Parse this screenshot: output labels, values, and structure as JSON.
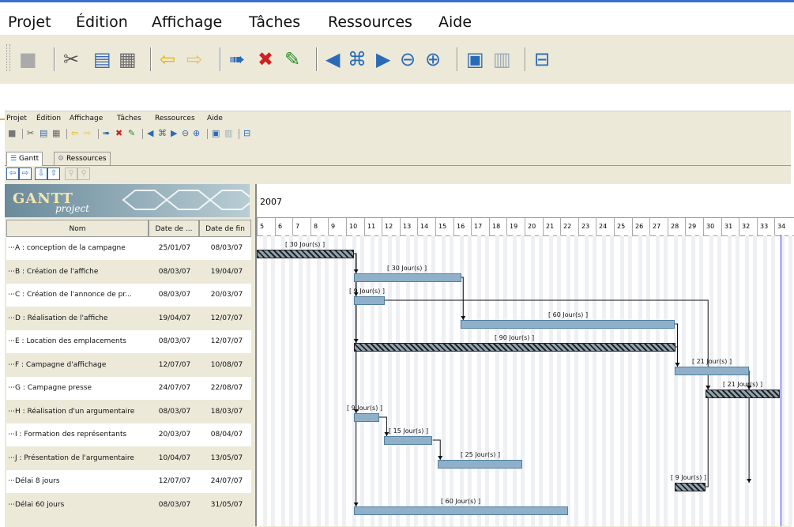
{
  "menu": [
    "Projet",
    "Édition",
    "Affichage",
    "Tâches",
    "Ressources",
    "Aide"
  ],
  "toolbar_icons": [
    "save-icon",
    "cut-icon",
    "copy-icon",
    "paste-icon",
    "undo-icon",
    "redo-icon",
    "new-task-icon",
    "delete-task-icon",
    "properties-icon",
    "unindent-icon",
    "link-icon",
    "indent-icon",
    "zoom-out-icon",
    "zoom-in-icon",
    "print-preview-icon",
    "resource-icon",
    "export-icon"
  ],
  "tabs": {
    "gantt": "Gantt",
    "resources": "Ressources"
  },
  "logo": {
    "text": "GANTT",
    "sub": "project"
  },
  "columns": {
    "name": "Nom",
    "start": "Date de ...",
    "end": "Date de fin"
  },
  "year": "2007",
  "weeks": [
    "5",
    "6",
    "7",
    "8",
    "9",
    "10",
    "11",
    "12",
    "13",
    "14",
    "15",
    "16",
    "17",
    "18",
    "19",
    "20",
    "21",
    "22",
    "23",
    "24",
    "25",
    "26",
    "27",
    "28",
    "29",
    "30",
    "31",
    "32",
    "33",
    "34"
  ],
  "tasks": [
    {
      "name": "A : conception de la campagne",
      "start": "25/01/07",
      "end": "08/03/07",
      "label": "[ 30 Jour(s) ]"
    },
    {
      "name": "B : Création de l'affiche",
      "start": "08/03/07",
      "end": "19/04/07",
      "label": "[ 30 Jour(s) ]"
    },
    {
      "name": "C : Création de l'annonce de pr...",
      "start": "08/03/07",
      "end": "20/03/07",
      "label": "[ 9 Jour(s) ]"
    },
    {
      "name": "D : Réalisation de l'affiche",
      "start": "19/04/07",
      "end": "12/07/07",
      "label": "[ 60 Jour(s) ]"
    },
    {
      "name": "E : Location des emplacements",
      "start": "08/03/07",
      "end": "12/07/07",
      "label": "[ 90 Jour(s) ]"
    },
    {
      "name": "F : Campagne d'affichage",
      "start": "12/07/07",
      "end": "10/08/07",
      "label": "[ 21 Jour(s) ]"
    },
    {
      "name": "G : Campagne presse",
      "start": "24/07/07",
      "end": "22/08/07",
      "label": "[ 21 Jour(s) ]"
    },
    {
      "name": "H : Réalisation d'un argumentaire",
      "start": "08/03/07",
      "end": "18/03/07",
      "label": "[ 9 Jour(s) ]"
    },
    {
      "name": "I : Formation des représentants",
      "start": "20/03/07",
      "end": "08/04/07",
      "label": "[ 15 Jour(s) ]"
    },
    {
      "name": "J : Présentation de l'argumentaire",
      "start": "10/04/07",
      "end": "13/05/07",
      "label": "[ 25 Jour(s) ]"
    },
    {
      "name": "Délai 8 jours",
      "start": "12/07/07",
      "end": "24/07/07",
      "label": "[ 9 Jour(s) ]"
    },
    {
      "name": "Délai 60 jours",
      "start": "08/03/07",
      "end": "31/05/07",
      "label": "[ 60 Jour(s) ]"
    }
  ]
}
